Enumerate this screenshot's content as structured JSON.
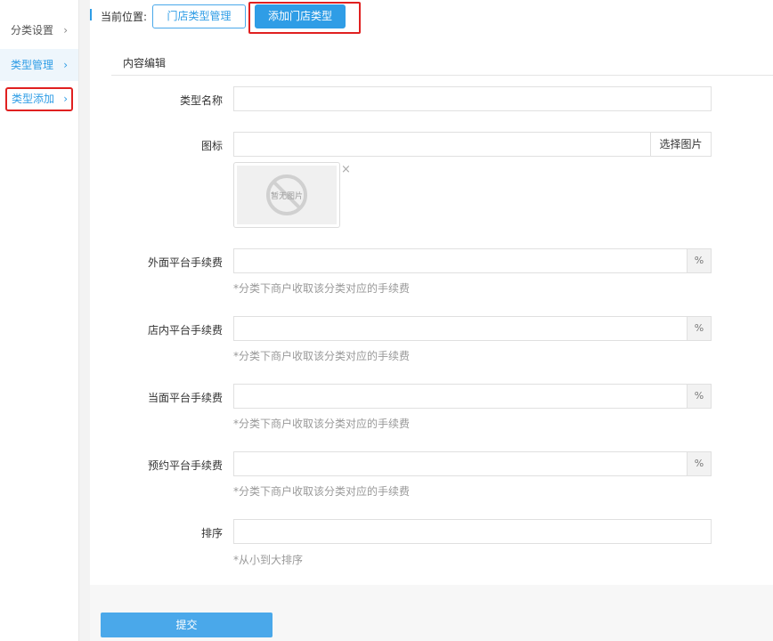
{
  "sidebar": {
    "items": [
      {
        "label": "分类设置"
      },
      {
        "label": "类型管理"
      },
      {
        "label": "类型添加"
      }
    ],
    "chevron": "›"
  },
  "breadcrumb": {
    "label": "当前位置:",
    "manage_button": "门店类型管理",
    "add_button": "添加门店类型"
  },
  "panel": {
    "title": "内容编辑"
  },
  "form": {
    "type_name": {
      "label": "类型名称",
      "value": ""
    },
    "icon": {
      "label": "图标",
      "value": "",
      "choose_button": "选择图片",
      "placeholder_image_text": "暂无图片",
      "close_icon": "×"
    },
    "fees": [
      {
        "label": "外面平台手续费",
        "value": "",
        "unit": "%",
        "hint": "*分类下商户收取该分类对应的手续费"
      },
      {
        "label": "店内平台手续费",
        "value": "",
        "unit": "%",
        "hint": "*分类下商户收取该分类对应的手续费"
      },
      {
        "label": "当面平台手续费",
        "value": "",
        "unit": "%",
        "hint": "*分类下商户收取该分类对应的手续费"
      },
      {
        "label": "预约平台手续费",
        "value": "",
        "unit": "%",
        "hint": "*分类下商户收取该分类对应的手续费"
      }
    ],
    "sort": {
      "label": "排序",
      "value": "",
      "hint": "*从小到大排序"
    },
    "submit_label": "提交"
  },
  "colors": {
    "accent": "#2f9de6",
    "highlight_border": "#e02020"
  }
}
